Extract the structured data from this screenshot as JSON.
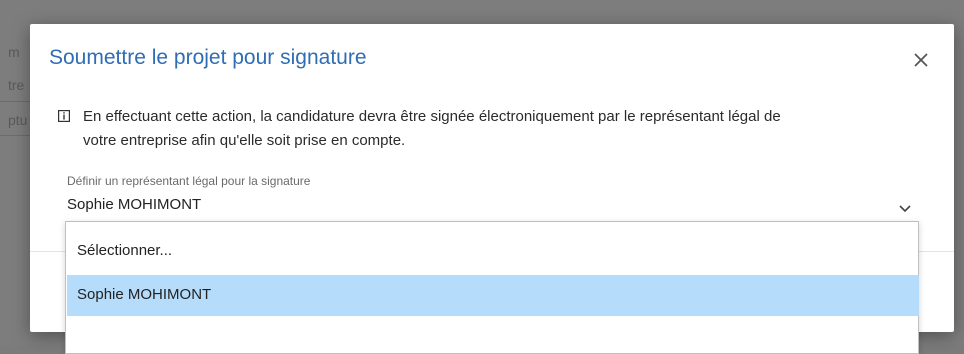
{
  "background": {
    "text_fragments": [
      "m",
      "tre",
      "ptu"
    ]
  },
  "modal": {
    "title": "Soumettre le projet pour signature",
    "close_icon": "close-icon",
    "info_icon": "info-icon",
    "info_line_1": "En effectuant cette action, la candidature devra être signée électroniquement par le représentant légal de",
    "info_line_2": "votre entreprise afin qu'elle soit prise en compte.",
    "field_label": "Définir un représentant légal pour la signature",
    "field_value": "Sophie MOHIMONT",
    "chevron_icon": "chevron-down-icon"
  },
  "dropdown": {
    "options": [
      {
        "label": "Sélectionner...",
        "selected": false
      },
      {
        "label": "Sophie MOHIMONT",
        "selected": true
      }
    ]
  },
  "colors": {
    "title": "#2f6db5",
    "selected_option": "#b6dcfb",
    "accent_button": "#d99a1e",
    "overlay": "#7b7b7b"
  }
}
